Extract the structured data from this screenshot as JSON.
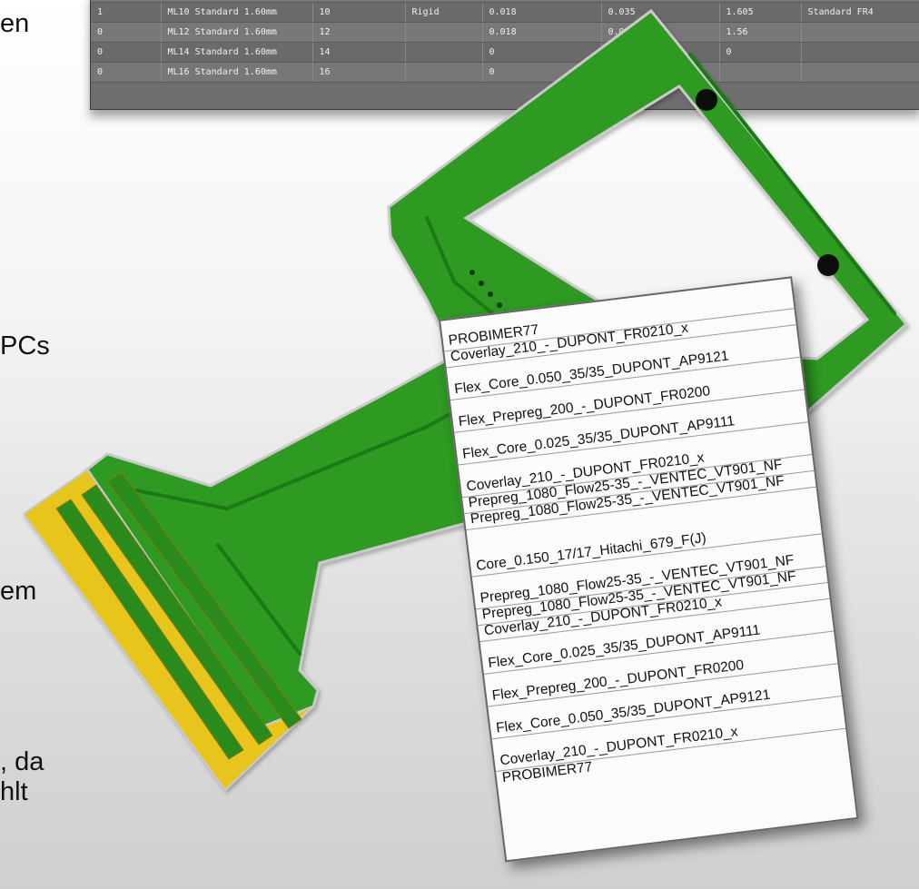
{
  "slide_fragments": [
    "en",
    "PCs",
    "em",
    ", da",
    "hlt"
  ],
  "stackup_table": {
    "rows": [
      [
        "1",
        "ML10 Standard 1.60mm",
        "10",
        "Rigid",
        "0.018",
        "0.035",
        "1.605",
        "Standard FR4"
      ],
      [
        "0",
        "ML12 Standard 1.60mm",
        "12",
        "",
        "0.018",
        "0.035",
        "1.56",
        ""
      ],
      [
        "0",
        "ML14 Standard 1.60mm",
        "14",
        "",
        "0",
        "",
        "0",
        ""
      ],
      [
        "0",
        "ML16 Standard 1.60mm",
        "16",
        "",
        "0",
        "",
        "",
        ""
      ]
    ]
  },
  "layer_stack": [
    {
      "label": "PROBIMER77",
      "size": "s"
    },
    {
      "label": "Coverlay_210_-_DUPONT_FR0210_x",
      "size": "s"
    },
    {
      "label": "Flex_Core_0.050_35/35_DUPONT_AP9121",
      "size": "m"
    },
    {
      "label": "Flex_Prepreg_200_-_DUPONT_FR0200",
      "size": "m"
    },
    {
      "label": "Flex_Core_0.025_35/35_DUPONT_AP9111",
      "size": "m"
    },
    {
      "label": "Coverlay_210_-_DUPONT_FR0210_x",
      "size": "m"
    },
    {
      "label": "Prepreg_1080_Flow25-35_-_VENTEC_VT901_NF",
      "size": "s"
    },
    {
      "label": "Prepreg_1080_Flow25-35_-_VENTEC_VT901_NF",
      "size": "s"
    },
    {
      "label": "Core_0.150_17/17_Hitachi_679_F(J)",
      "size": "l"
    },
    {
      "label": "Prepreg_1080_Flow25-35_-_VENTEC_VT901_NF",
      "size": "m"
    },
    {
      "label": "Prepreg_1080_Flow25-35_-_VENTEC_VT901_NF",
      "size": "s"
    },
    {
      "label": "Coverlay_210_-_DUPONT_FR0210_x",
      "size": "s"
    },
    {
      "label": "Flex_Core_0.025_35/35_DUPONT_AP9111",
      "size": "m"
    },
    {
      "label": "Flex_Prepreg_200_-_DUPONT_FR0200",
      "size": "m"
    },
    {
      "label": "Flex_Core_0.050_35/35_DUPONT_AP9121",
      "size": "m"
    },
    {
      "label": "Coverlay_210_-_DUPONT_FR0210_x",
      "size": "m"
    },
    {
      "label": "PROBIMER77",
      "size": "s"
    }
  ],
  "colors": {
    "pcb_green": "#2d9a22",
    "pcb_green_dark": "#1c6f14",
    "pcb_outline": "#cfcfcf",
    "connector_gold": "#e7c51a",
    "pad_green": "#2a8a1c"
  }
}
